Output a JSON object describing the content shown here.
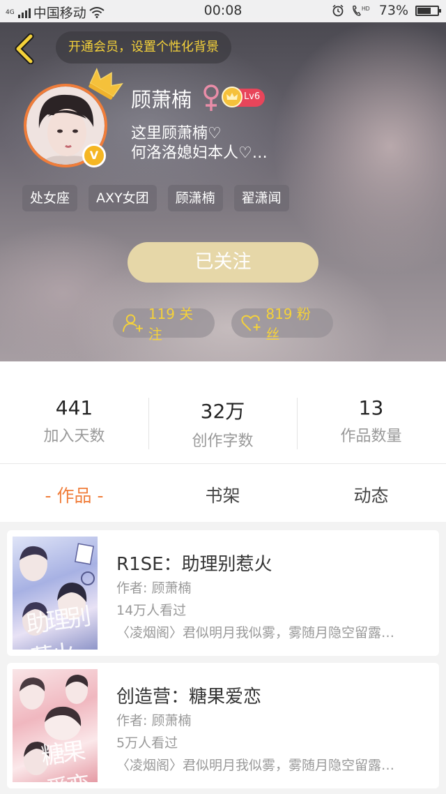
{
  "status_bar": {
    "network": "4G",
    "carrier": "中国移动",
    "time": "00:08",
    "battery_percent": "73%",
    "battery_level": 0.73
  },
  "header": {
    "vip_banner": "开通会员，设置个性化背景",
    "user_name": "顾萧楠",
    "gender_symbol": "♀",
    "level": "Lv6",
    "v_badge": "V",
    "bio": [
      "这里顾萧楠♡",
      "何洛洛媳妇本人♡…"
    ],
    "tags": [
      "处女座",
      "AXY女团",
      "顾潇楠",
      "翟潇闻"
    ],
    "follow_button": "已关注",
    "following": "119 关注",
    "fans": "819 粉丝"
  },
  "stats": [
    {
      "value": "441",
      "label": "加入天数"
    },
    {
      "value": "32万",
      "label": "创作字数"
    },
    {
      "value": "13",
      "label": "作品数量"
    }
  ],
  "tabs": [
    "- 作品 -",
    "书架",
    "动态"
  ],
  "active_tab": 0,
  "books": [
    {
      "title": "R1SE：助理别惹火",
      "author": "作者: 顾萧楠",
      "views": "14万人看过",
      "desc": "〈凌烟阁〉君似明月我似雾，雾随月隐空留露…",
      "cover_text": "助理别惹火"
    },
    {
      "title": "创造营：糖果爱恋",
      "author": "作者: 顾萧楠",
      "views": "5万人看过",
      "desc": "〈凌烟阁〉君似明月我似雾，雾随月隐空留露…",
      "cover_text": "糖果爱恋"
    }
  ],
  "colors": {
    "accent": "#f07d3a",
    "vip_yellow": "#f5d23a",
    "follow_button": "#e6d7a8"
  },
  "icons": [
    "signal-icon",
    "wifi-icon",
    "alarm-icon",
    "hd-call-icon",
    "battery-icon",
    "back-arrow-icon",
    "crown-icon",
    "female-icon",
    "level-crown-icon",
    "following-icon",
    "fans-icon"
  ]
}
